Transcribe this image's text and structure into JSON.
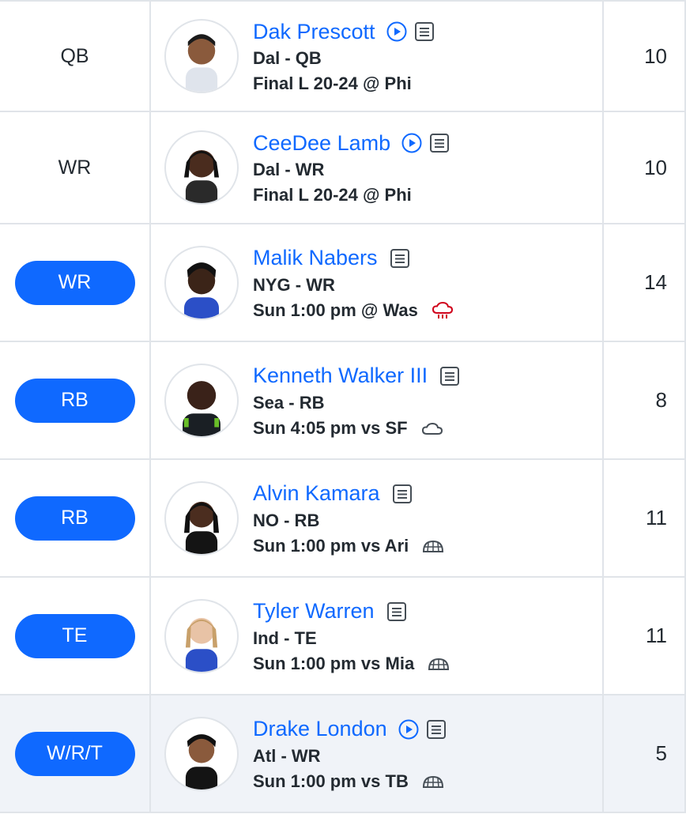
{
  "rows": [
    {
      "slot": "QB",
      "slot_style": "text",
      "name": "Dak Prescott",
      "has_video": true,
      "team_pos": "Dal - QB",
      "game": "Final L 20-24 @ Phi",
      "weather": "",
      "points": "10"
    },
    {
      "slot": "WR",
      "slot_style": "text",
      "name": "CeeDee Lamb",
      "has_video": true,
      "team_pos": "Dal - WR",
      "game": "Final L 20-24 @ Phi",
      "weather": "",
      "points": "10"
    },
    {
      "slot": "WR",
      "slot_style": "button",
      "name": "Malik Nabers",
      "has_video": false,
      "team_pos": "NYG - WR",
      "game": "Sun 1:00 pm @ Was",
      "weather": "rain-cloud-icon",
      "points": "14"
    },
    {
      "slot": "RB",
      "slot_style": "button",
      "name": "Kenneth Walker III",
      "has_video": false,
      "team_pos": "Sea - RB",
      "game": "Sun 4:05 pm vs SF",
      "weather": "cloud-icon",
      "points": "8"
    },
    {
      "slot": "RB",
      "slot_style": "button",
      "name": "Alvin Kamara",
      "has_video": false,
      "team_pos": "NO - RB",
      "game": "Sun 1:00 pm vs Ari",
      "weather": "dome-icon",
      "points": "11"
    },
    {
      "slot": "TE",
      "slot_style": "button",
      "name": "Tyler Warren",
      "has_video": false,
      "team_pos": "Ind - TE",
      "game": "Sun 1:00 pm vs Mia",
      "weather": "dome-icon",
      "points": "11"
    },
    {
      "slot": "W/R/T",
      "slot_style": "button",
      "name": "Drake London",
      "has_video": true,
      "team_pos": "Atl - WR",
      "game": "Sun 1:00 pm vs TB",
      "weather": "dome-icon",
      "points": "5",
      "highlight": true
    }
  ],
  "colors": {
    "accent": "#0f69ff",
    "border": "#e0e4e9",
    "rain": "#d0021b",
    "highlight_row": "#f0f3f8"
  }
}
